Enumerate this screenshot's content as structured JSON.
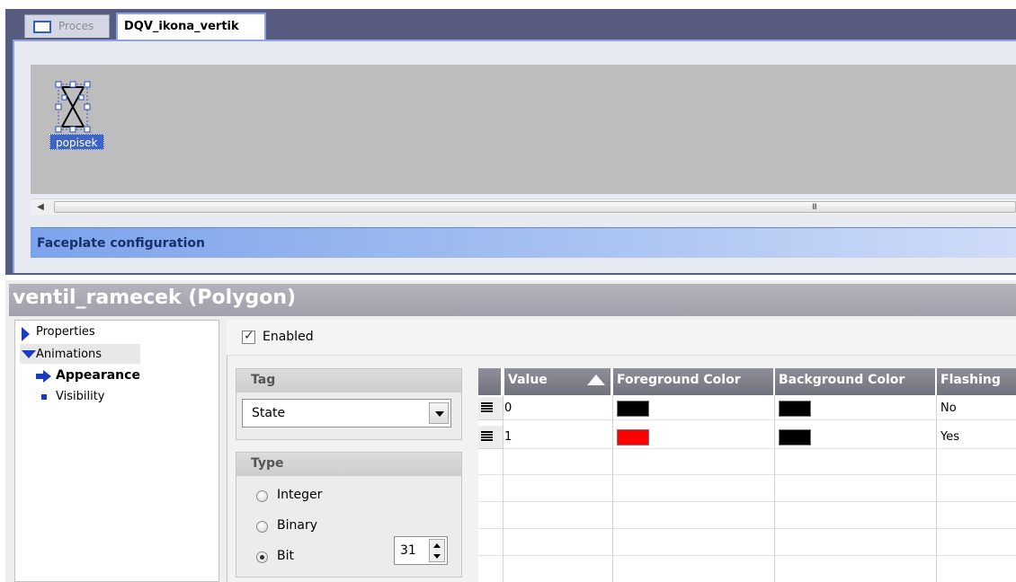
{
  "tabs": [
    {
      "label": "Proces",
      "active": false
    },
    {
      "label": "DQV_ikona_vertik",
      "active": true
    }
  ],
  "canvas": {
    "selected_object_label": "popisek",
    "scrollbar_grip": "III"
  },
  "faceplate_bar": {
    "label": "Faceplate configuration"
  },
  "inspector": {
    "title": "ventil_ramecek (Polygon)",
    "nav": {
      "properties": "Properties",
      "animations": "Animations",
      "appearance": "Appearance",
      "visibility": "Visibility"
    },
    "enabled": {
      "label": "Enabled",
      "checked": true
    },
    "tag_group": {
      "title": "Tag",
      "selected": "State"
    },
    "type_group": {
      "title": "Type",
      "options": [
        {
          "label": "Integer",
          "selected": false
        },
        {
          "label": "Binary",
          "selected": false
        },
        {
          "label": "Bit",
          "selected": true
        }
      ],
      "bit_value": "31"
    },
    "table": {
      "columns": [
        "Value",
        "Foreground Color",
        "Background Color",
        "Flashing"
      ],
      "rows": [
        {
          "value": "0",
          "foreground": "#000000",
          "background": "#000000",
          "flashing": "No"
        },
        {
          "value": "1",
          "foreground": "#ff0000",
          "background": "#000000",
          "flashing": "Yes"
        }
      ]
    }
  },
  "colors": {
    "editor_frame": "#585b80",
    "accent_blue": "#3d63c4",
    "faceplate_bar": "#7ca3ec",
    "inspector_header": "#a8a8b4",
    "table_header": "#7f7f8b"
  }
}
